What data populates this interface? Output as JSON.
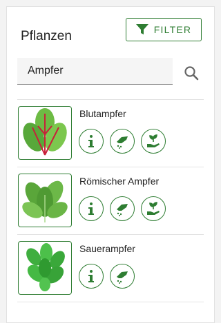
{
  "header": {
    "title": "Pflanzen",
    "filter_label": "FILTER"
  },
  "search": {
    "value": "Ampfer",
    "icon": "search-icon"
  },
  "plants": [
    {
      "name": "Blutampfer",
      "actions": [
        "info-icon",
        "sow-icon",
        "plant-hand-icon"
      ]
    },
    {
      "name": "Römischer Ampfer",
      "actions": [
        "info-icon",
        "sow-icon",
        "plant-hand-icon"
      ]
    },
    {
      "name": "Sauerampfer",
      "actions": [
        "info-icon",
        "sow-icon"
      ]
    }
  ],
  "colors": {
    "accent": "#2e7d32",
    "background": "#f3f3f3"
  }
}
